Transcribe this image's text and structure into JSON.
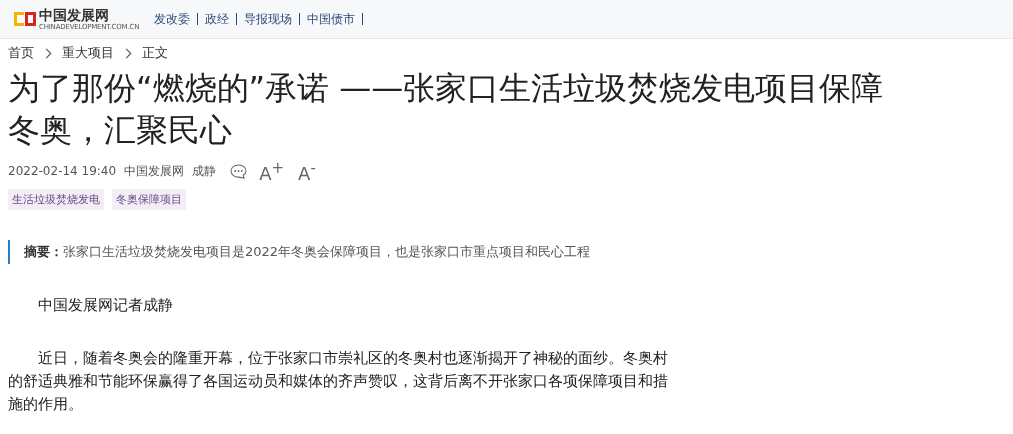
{
  "header": {
    "logo": {
      "name": "中国发展网",
      "domain": "CHINADEVELOPMENT.COM.CN"
    },
    "nav": [
      {
        "label": "发改委"
      },
      {
        "label": "政经"
      },
      {
        "label": "导报现场"
      },
      {
        "label": "中国债市"
      }
    ]
  },
  "breadcrumb": [
    "首页",
    "重大项目",
    "正文"
  ],
  "article": {
    "title": "为了那份“燃烧的”承诺 ——张家口生活垃圾焚烧发电项目保障冬奥，汇聚民心",
    "meta": {
      "date": "2022-02-14 19:40",
      "source": "中国发展网",
      "author": "成静",
      "font_buttons": [
        "A$^{+}$",
        "A$^{-}$"
      ]
    },
    "tags": [
      "生活垃圾焚烧发电",
      "冬奥保障项目"
    ],
    "abstract": {
      "label": "摘要：",
      "text": "张家口生活垃圾焚烧发电项目是2022年冬奥会保障项目，也是张家口市重点项目和民心工程"
    },
    "paragraphs": [
      "中国发展网记者成静",
      "近日，随着冬奥会的隆重开幕，位于张家口市崇礼区的冬奥村也逐渐揭开了神秘的面纱。冬奥村的舒适典雅和节能环保赢得了各国运动员和媒体的齐声赞叹，这背后离不开张家口各项保障项目和措施的作用。"
    ]
  }
}
